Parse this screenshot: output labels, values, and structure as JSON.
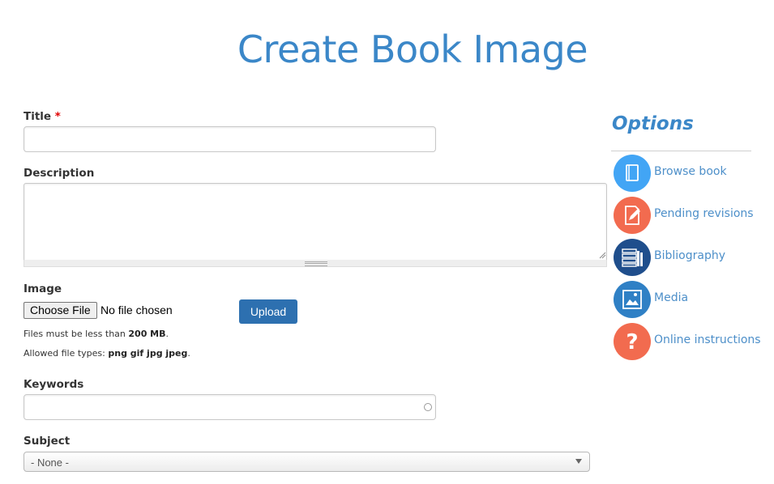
{
  "page": {
    "title": "Create Book Image"
  },
  "form": {
    "title_label": "Title",
    "required_marker": "*",
    "title_value": "",
    "description_label": "Description",
    "description_value": "",
    "image_label": "Image",
    "choose_file_label": "Choose File",
    "file_status": "No file chosen",
    "upload_label": "Upload",
    "size_help_prefix": "Files must be less than ",
    "size_limit": "200 MB",
    "size_help_suffix": ".",
    "types_help_prefix": "Allowed file types: ",
    "allowed_types": "png gif jpg jpeg",
    "types_help_suffix": ".",
    "keywords_label": "Keywords",
    "keywords_value": "",
    "subject_label": "Subject",
    "subject_selected": "- None -"
  },
  "sidebar": {
    "heading": "Options",
    "items": [
      {
        "label": "Browse book",
        "icon": "book-icon",
        "color": "#42a5f5"
      },
      {
        "label": "Pending revisions",
        "icon": "edit-document-icon",
        "color": "#f26b4f"
      },
      {
        "label": "Bibliography",
        "icon": "books-stack-icon",
        "color": "#1f4e8c"
      },
      {
        "label": "Media",
        "icon": "image-icon",
        "color": "#2f80c5"
      },
      {
        "label": "Online instructions",
        "icon": "question-icon",
        "color": "#f26b4f"
      }
    ]
  },
  "colors": {
    "accent": "#3b87c8",
    "link": "#4d8fc9",
    "upload_button": "#2d70b0",
    "required": "#e00000"
  }
}
